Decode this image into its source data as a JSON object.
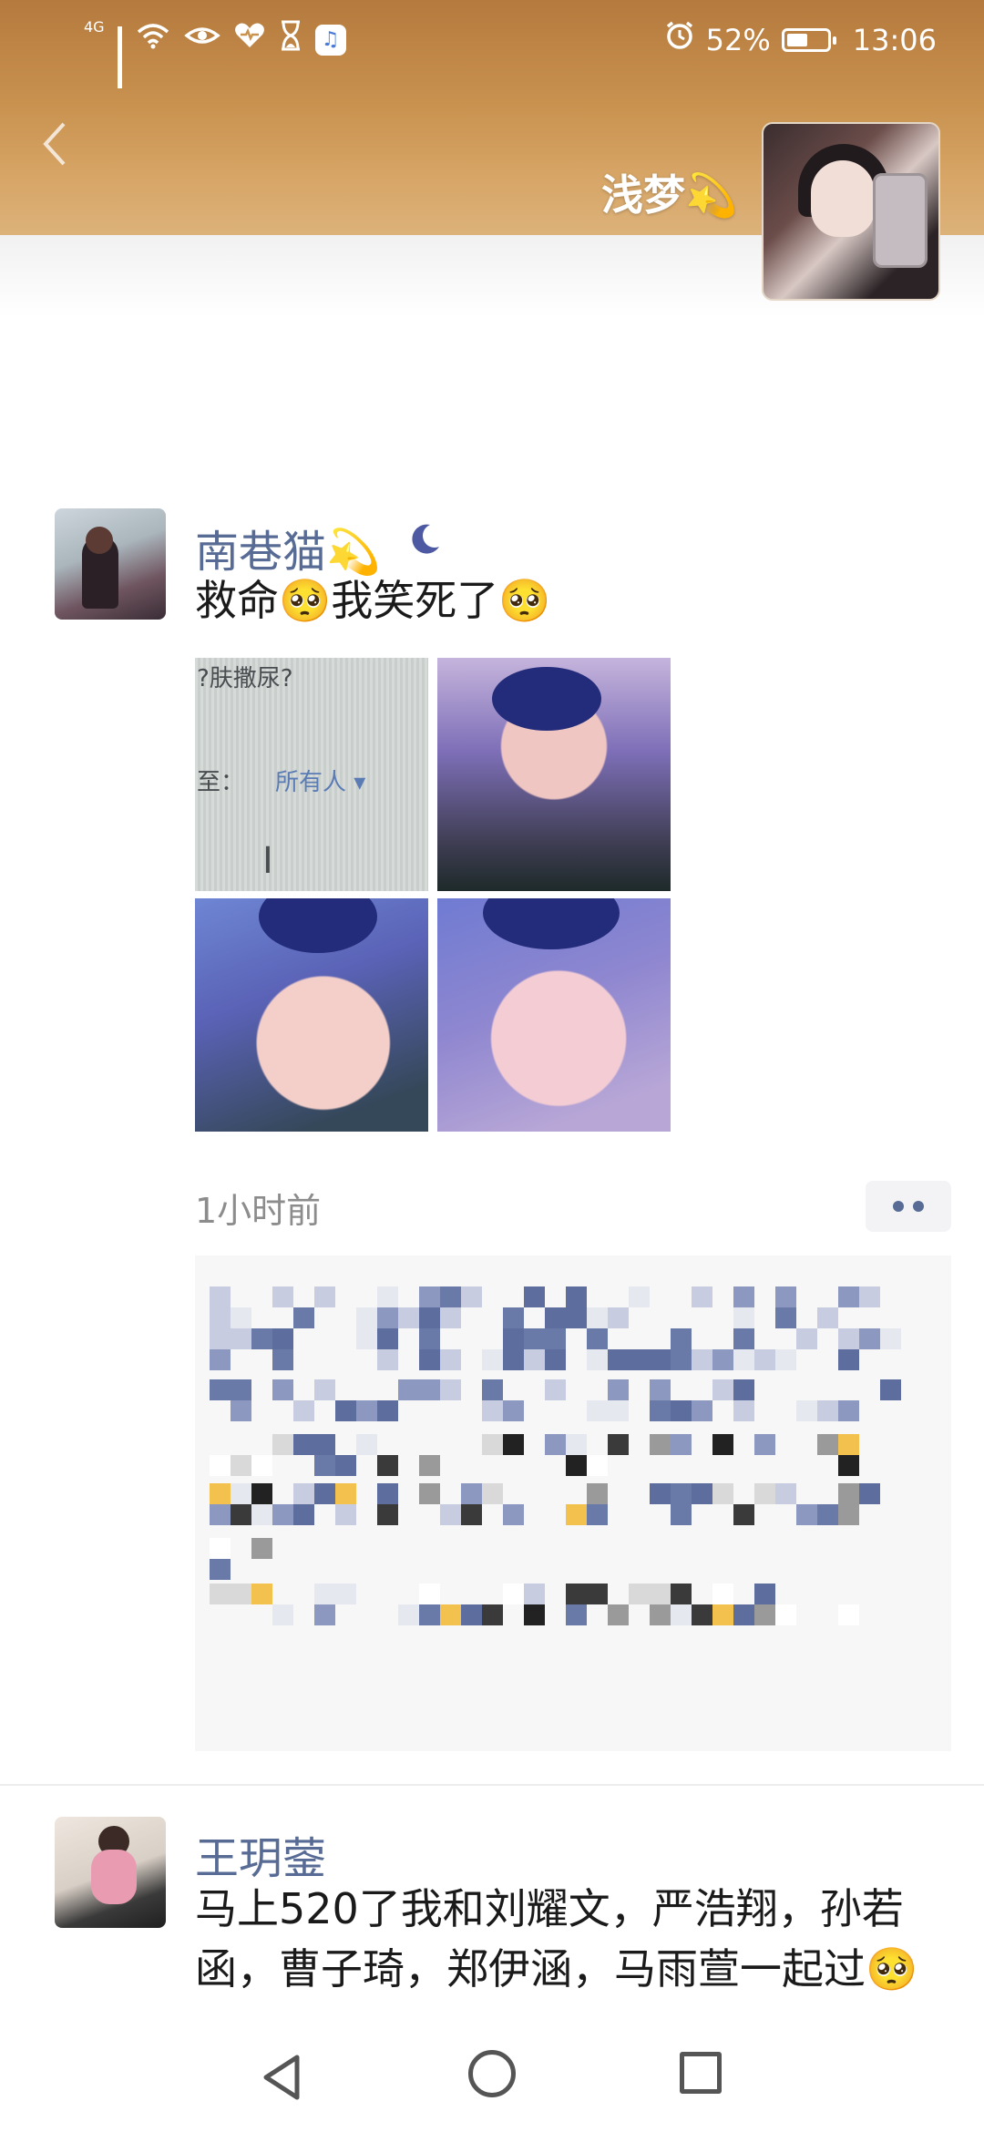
{
  "status_bar": {
    "network": "4G",
    "battery_percent": "52%",
    "battery_level": 0.52,
    "time": "13:06",
    "icons": [
      "signal-icon",
      "wifi-icon",
      "eye-icon",
      "heart-icon",
      "hourglass-icon",
      "music-app-icon",
      "alarm-icon",
      "battery-icon"
    ]
  },
  "cover": {
    "back_icon": "chevron-left-icon",
    "owner_name": "浅梦💫"
  },
  "posts": [
    {
      "author": "南巷猫💫",
      "status_icon": "moon-icon",
      "text": "救命🥺我笑死了🥺",
      "photo_1_text": [
        "?肤撒尿?",
        "至：",
        "所有人 ▾",
        "I"
      ],
      "time": "1小时前",
      "more_icon": "more-dots-icon"
    },
    {
      "author": "王玥蓥",
      "text": "马上520了我和刘耀文，严浩翔，孙若函，曹子琦，郑伊涵，马雨萱一起过🥺"
    }
  ],
  "colors": {
    "accent_name": "#576b95",
    "cover_top": "#b57a3e",
    "cover_bottom": "#dcb27a"
  },
  "nav_bar": {
    "icons": [
      "nav-back-icon",
      "nav-home-icon",
      "nav-recent-icon"
    ]
  }
}
